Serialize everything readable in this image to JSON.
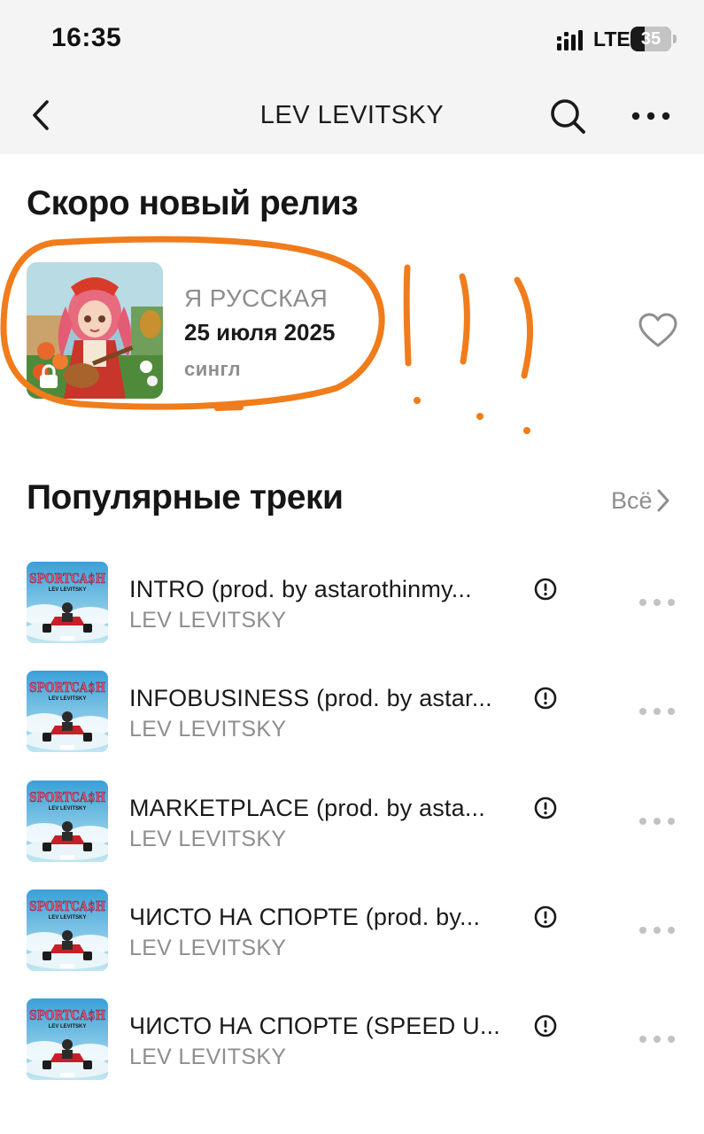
{
  "status_bar": {
    "time": "16:35",
    "network": "LTE",
    "battery": "35",
    "battery_level_percent": 35
  },
  "header": {
    "title": "LEV LEVITSKY",
    "icons": [
      "back-chevron-icon",
      "search-icon",
      "more-dots-icon"
    ]
  },
  "upcoming": {
    "heading": "Скоро новый релиз",
    "release": {
      "title": "Я РУССКАЯ",
      "date": "25 июля 2025",
      "type": "сингл",
      "locked": true,
      "liked": false
    }
  },
  "popular": {
    "heading": "Популярные треки",
    "see_all": "Всё",
    "tracks": [
      {
        "title": "INTRO (prod. by astarothinmy...",
        "artist": "LEV LEVITSKY",
        "explicit": true
      },
      {
        "title": "INFOBUSINESS (prod. by astar...",
        "artist": "LEV LEVITSKY",
        "explicit": true
      },
      {
        "title": "MARKETPLACE (prod. by asta...",
        "artist": "LEV LEVITSKY",
        "explicit": true
      },
      {
        "title": "ЧИСТО НА СПОРТЕ (prod. by...",
        "artist": "LEV LEVITSKY",
        "explicit": true
      },
      {
        "title": "ЧИСТО НА СПОРТЕ (SPEED U...",
        "artist": "LEV LEVITSKY",
        "explicit": true
      }
    ],
    "cover_art": {
      "logo_text": "SPORTCA$H",
      "artist_text": "LEV LEVITSKY"
    }
  },
  "colors": {
    "bar_background": "#f4f4f4",
    "annotation": "#f07c1b",
    "muted_text": "#8e8e8e"
  }
}
